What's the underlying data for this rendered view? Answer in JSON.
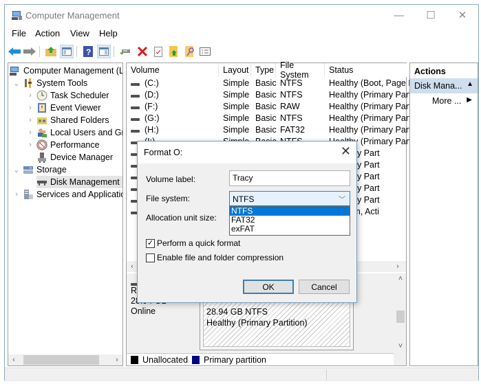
{
  "window": {
    "title": "Computer Management",
    "controls": {
      "minimize": "—",
      "maximize": "☐",
      "close": "✕"
    }
  },
  "menu": [
    "File",
    "Action",
    "View",
    "Help"
  ],
  "toolbar": [
    {
      "icon": "back-arrow-icon"
    },
    {
      "icon": "forward-arrow-icon"
    },
    {
      "icon": "up-folder-icon"
    },
    {
      "icon": "show-hide-console-tree-icon"
    },
    {
      "icon": "help-icon"
    },
    {
      "icon": "show-hide-action-pane-icon"
    },
    {
      "icon": "connect-drive-icon"
    },
    {
      "icon": "delete-icon"
    },
    {
      "icon": "properties-icon"
    },
    {
      "icon": "export-icon"
    },
    {
      "icon": "search-icon"
    },
    {
      "icon": "settings-list-icon"
    }
  ],
  "tree": {
    "root": "Computer Management (Local)",
    "items": [
      {
        "label": "System Tools",
        "level": 1,
        "expanded": true
      },
      {
        "label": "Task Scheduler",
        "level": 2
      },
      {
        "label": "Event Viewer",
        "level": 2
      },
      {
        "label": "Shared Folders",
        "level": 2
      },
      {
        "label": "Local Users and Groups",
        "level": 2
      },
      {
        "label": "Performance",
        "level": 2
      },
      {
        "label": "Device Manager",
        "level": 2
      },
      {
        "label": "Storage",
        "level": 1,
        "expanded": true
      },
      {
        "label": "Disk Management",
        "level": 2,
        "selected": true
      },
      {
        "label": "Services and Applications",
        "level": 1
      }
    ]
  },
  "volumes": {
    "columns": [
      "Volume",
      "Layout",
      "Type",
      "File System",
      "Status"
    ],
    "rows": [
      {
        "volume": "(C:)",
        "layout": "Simple",
        "type": "Basic",
        "fs": "NTFS",
        "status": "Healthy (Boot, Page F"
      },
      {
        "volume": "(D:)",
        "layout": "Simple",
        "type": "Basic",
        "fs": "NTFS",
        "status": "Healthy (Primary Part"
      },
      {
        "volume": "(F:)",
        "layout": "Simple",
        "type": "Basic",
        "fs": "RAW",
        "status": "Healthy (Primary Part"
      },
      {
        "volume": "(G:)",
        "layout": "Simple",
        "type": "Basic",
        "fs": "NTFS",
        "status": "Healthy (Primary Part"
      },
      {
        "volume": "(H:)",
        "layout": "Simple",
        "type": "Basic",
        "fs": "FAT32",
        "status": "Healthy (Primary Part"
      },
      {
        "volume": "(I:)",
        "layout": "Simple",
        "type": "Basic",
        "fs": "NTFS",
        "status": "Healthy (Primary Part"
      },
      {
        "volume": "",
        "layout": "",
        "type": "",
        "fs": "",
        "status": "(Primary Part"
      },
      {
        "volume": "",
        "layout": "",
        "type": "",
        "fs": "",
        "status": "(Primary Part"
      },
      {
        "volume": "",
        "layout": "",
        "type": "",
        "fs": "",
        "status": "(Primary Part"
      },
      {
        "volume": "",
        "layout": "",
        "type": "",
        "fs": "",
        "status": "(Primary Part"
      },
      {
        "volume": "",
        "layout": "",
        "type": "",
        "fs": "",
        "status": "(Primary Part"
      },
      {
        "volume": "",
        "layout": "",
        "type": "",
        "fs": "",
        "status": "(System, Acti"
      }
    ]
  },
  "disk": {
    "label_partial": "Re",
    "size": "28.94 GB",
    "state": "Online",
    "partition_size_fs": "28.94 GB NTFS",
    "partition_status": "Healthy (Primary Partition)"
  },
  "legend": [
    {
      "label": "Unallocated",
      "color": "#000000"
    },
    {
      "label": "Primary partition",
      "color": "#000080"
    }
  ],
  "actions": {
    "header": "Actions",
    "group": "Disk Mana...",
    "more": "More ..."
  },
  "dialog": {
    "title": "Format O:",
    "close": "✕",
    "volume_label_caption": "Volume label:",
    "volume_label_value": "Tracy",
    "file_system_caption": "File system:",
    "file_system_value": "NTFS",
    "file_system_options": [
      "NTFS",
      "FAT32",
      "exFAT"
    ],
    "file_system_highlighted": "NTFS",
    "allocation_caption": "Allocation unit size:",
    "quick_format_label": "Perform a quick format",
    "quick_format_checked": true,
    "compression_label": "Enable file and folder compression",
    "compression_checked": false,
    "ok_label": "OK",
    "cancel_label": "Cancel"
  }
}
